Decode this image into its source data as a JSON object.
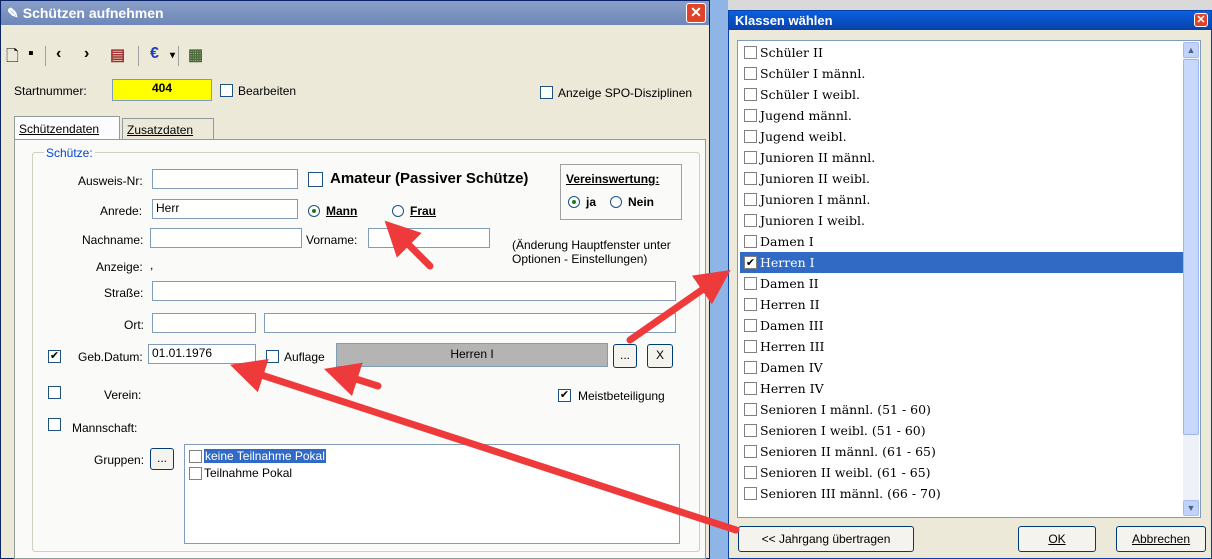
{
  "main_window": {
    "title": "Schützen aufnehmen",
    "close_icon": "close-icon",
    "toolbar": {
      "icons": [
        "new-document-icon",
        "save-icon",
        "previous-icon",
        "next-icon",
        "print-icon",
        "euro-icon",
        "dropdown-icon",
        "calculator-icon"
      ]
    },
    "startnummer_label": "Startnummer:",
    "startnummer_value": "404",
    "bearbeiten_label": "Bearbeiten",
    "anzeige_spo_label": "Anzeige SPO-Disziplinen",
    "tabs": [
      {
        "label": "Schützendaten"
      },
      {
        "label": "Zusatzdaten"
      }
    ],
    "group_label": "Schütze:",
    "ausweis_label": "Ausweis-Nr:",
    "amateur_label": "Amateur (Passiver Schütze)",
    "vereinswertung_label": "Vereinswertung:",
    "ja_label": "ja",
    "nein_label": "Nein",
    "anrede_label": "Anrede:",
    "anrede_value": "Herr",
    "mann_label": "Mann",
    "frau_label": "Frau",
    "nachname_label": "Nachname:",
    "vorname_label": "Vorname:",
    "hint_text": "(Änderung Hauptfenster unter Optionen - Einstellungen)",
    "anzeige_label": "Anzeige:",
    "anzeige_value": ",",
    "strasse_label": "Straße:",
    "ort_label": "Ort:",
    "geb_label": "Geb.Datum:",
    "geb_value": "01.01.1976",
    "auflage_label": "Auflage",
    "klasse_value": "Herren I",
    "browse_label": "...",
    "clear_label": "X",
    "verein_label": "Verein:",
    "meist_label": "Meistbeteiligung",
    "mannschaft_label": "Mannschaft:",
    "gruppen_label": "Gruppen:",
    "gruppen_browse": "...",
    "gruppen_items": [
      "keine Teilnahme Pokal",
      "Teilnahme Pokal"
    ]
  },
  "class_window": {
    "title": "Klassen wählen",
    "items": [
      {
        "label": "Schüler II",
        "checked": false
      },
      {
        "label": "Schüler I männl.",
        "checked": false
      },
      {
        "label": "Schüler I weibl.",
        "checked": false
      },
      {
        "label": "Jugend männl.",
        "checked": false
      },
      {
        "label": "Jugend weibl.",
        "checked": false
      },
      {
        "label": "Junioren II männl.",
        "checked": false
      },
      {
        "label": "Junioren II weibl.",
        "checked": false
      },
      {
        "label": "Junioren I männl.",
        "checked": false
      },
      {
        "label": "Junioren I weibl.",
        "checked": false
      },
      {
        "label": "Damen I",
        "checked": false
      },
      {
        "label": "Herren I",
        "checked": true
      },
      {
        "label": "Damen II",
        "checked": false
      },
      {
        "label": "Herren II",
        "checked": false
      },
      {
        "label": "Damen III",
        "checked": false
      },
      {
        "label": "Herren III",
        "checked": false
      },
      {
        "label": "Damen IV",
        "checked": false
      },
      {
        "label": "Herren IV",
        "checked": false
      },
      {
        "label": "Senioren I männl. (51 - 60)",
        "checked": false
      },
      {
        "label": "Senioren I weibl. (51 - 60)",
        "checked": false
      },
      {
        "label": "Senioren II männl. (61 - 65)",
        "checked": false
      },
      {
        "label": "Senioren II weibl. (61 - 65)",
        "checked": false
      },
      {
        "label": "Senioren III männl. (66 - 70)",
        "checked": false
      }
    ],
    "jahrgang_button": "<< Jahrgang übertragen",
    "ok_button": "OK",
    "abbrechen_button": "Abbrechen"
  },
  "colors": {
    "annotation_arrow": "#ee3a3a",
    "startnummer_bg": "#ffff00",
    "selection": "#316ac5"
  }
}
